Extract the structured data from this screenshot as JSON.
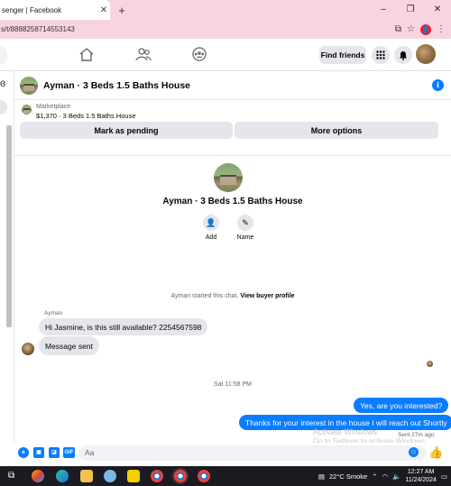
{
  "browser": {
    "tab_title": "senger | Facebook",
    "tab_close": "✕",
    "new_tab": "+",
    "url": "s/t/8888258714553143",
    "controls": [
      "–",
      "❐",
      "✕"
    ]
  },
  "nav": {
    "find_friends": "Find friends",
    "menu_glyph": "⋮⋮⋮",
    "messenger_glyph": "●"
  },
  "chat": {
    "title": "Ayman · 3 Beds 1.5 Baths House",
    "info": "i",
    "marketplace_label": "Marketplace",
    "listing": "$1,370 · 3 Beds 1.5 Baths House",
    "mark_pending": "Mark as pending",
    "more_options": "More options"
  },
  "intro": {
    "name": "Ayman · 3 Beds 1.5 Baths House",
    "add_label": "Add",
    "name_label": "Name"
  },
  "messages": {
    "started_prefix": "Ayman started this chat.",
    "view_profile": "View buyer profile",
    "sender": "Ayman",
    "in_1": "Hi Jasmine, is this still available?   2254567598",
    "in_2": "Message sent",
    "timestamp": "Sat 11:58 PM",
    "out_1": "Yes, are you interested?",
    "out_2": "Thanks for your interest in the house I will reach out Shortly",
    "sent_ago": "Sent 27m ago"
  },
  "watermark": {
    "line1": "Activate Windows",
    "line2": "Go to Settings to activate Windows."
  },
  "composer": {
    "placeholder": "Aa",
    "gif": "GIF"
  },
  "taskbar": {
    "weather": "22°C  Smoke",
    "time": "12:27 AM",
    "date": "11/24/2024"
  }
}
